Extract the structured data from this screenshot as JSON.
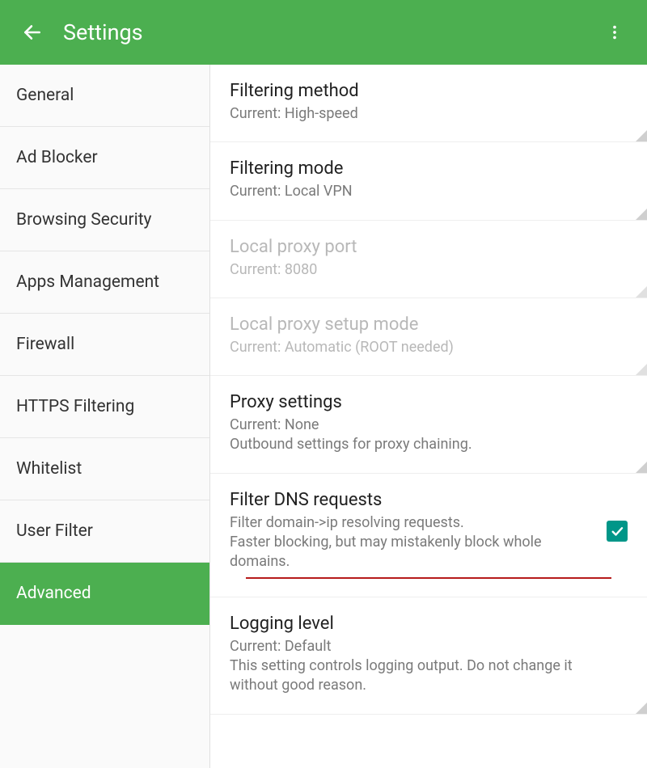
{
  "appbar": {
    "title": "Settings"
  },
  "sidebar": {
    "items": [
      {
        "label": "General"
      },
      {
        "label": "Ad Blocker"
      },
      {
        "label": "Browsing Security"
      },
      {
        "label": "Apps Management"
      },
      {
        "label": "Firewall"
      },
      {
        "label": "HTTPS Filtering"
      },
      {
        "label": "Whitelist"
      },
      {
        "label": "User Filter"
      },
      {
        "label": "Advanced"
      }
    ]
  },
  "settings": {
    "filtering_method": {
      "title": "Filtering method",
      "sub": "Current: High-speed"
    },
    "filtering_mode": {
      "title": "Filtering mode",
      "sub": "Current: Local VPN"
    },
    "local_proxy_port": {
      "title": "Local proxy port",
      "sub": "Current: 8080"
    },
    "local_proxy_setup": {
      "title": "Local proxy setup mode",
      "sub": "Current: Automatic (ROOT needed)"
    },
    "proxy_settings": {
      "title": "Proxy settings",
      "sub1": "Current: None",
      "sub2": "Outbound settings for proxy chaining."
    },
    "filter_dns": {
      "title": "Filter DNS requests",
      "sub1": "Filter domain->ip resolving requests.",
      "sub2": "Faster blocking, but may mistakenly block whole domains."
    },
    "logging_level": {
      "title": "Logging level",
      "sub1": "Current: Default",
      "sub2": "This setting controls logging output. Do not change it without good reason."
    }
  }
}
